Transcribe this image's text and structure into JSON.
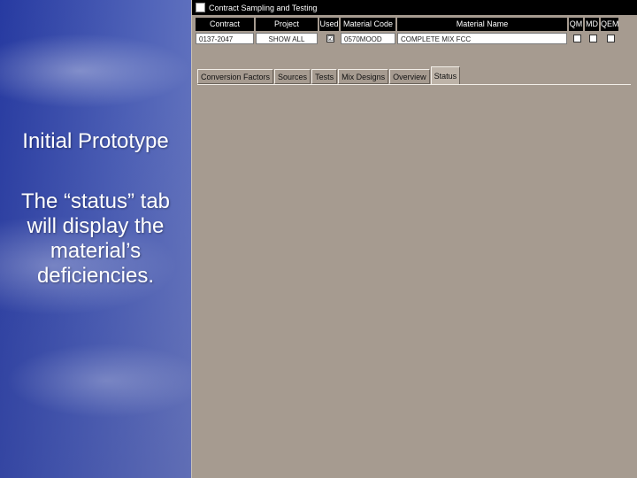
{
  "slide": {
    "heading": "Initial Prototype",
    "body": "The “status” tab will display the material’s deficiencies."
  },
  "window": {
    "title": "Contract Sampling and Testing"
  },
  "grid": {
    "headers": {
      "contract": "Contract",
      "project": "Project",
      "used": "Used",
      "material_code": "Material Code",
      "material_name": "Material Name",
      "qm": "QM",
      "md": "MD",
      "qem": "QEM"
    },
    "row": {
      "contract": "0137-2047",
      "project": "SHOW ALL",
      "used_checked": "☑",
      "material_code": "0570MOOD",
      "material_name": "COMPLETE MIX FCC",
      "qm_checked": "",
      "md_checked": "",
      "qem_checked": ""
    }
  },
  "tabs": [
    {
      "label": "Conversion Factors"
    },
    {
      "label": "Sources"
    },
    {
      "label": "Tests"
    },
    {
      "label": "Mix Designs"
    },
    {
      "label": "Overview"
    },
    {
      "label": "Status"
    }
  ]
}
